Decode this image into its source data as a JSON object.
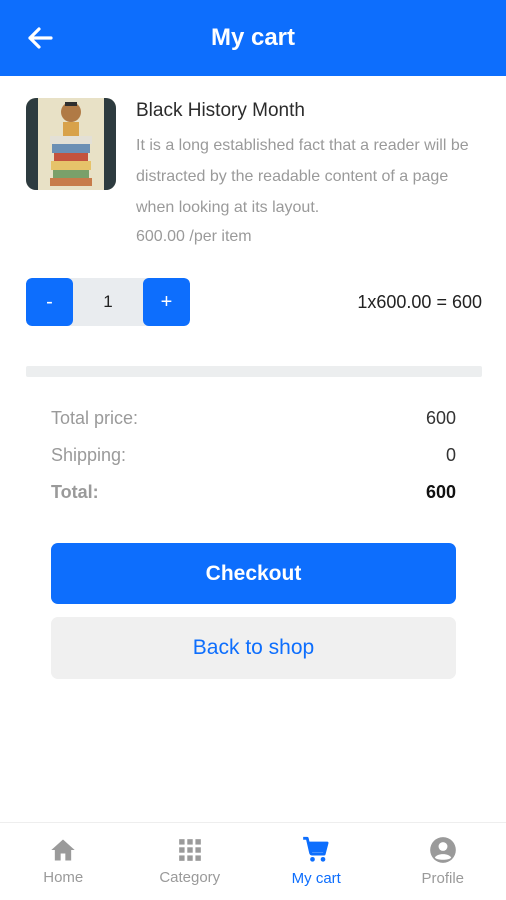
{
  "header": {
    "title": "My cart",
    "back_icon": "arrow-left-icon"
  },
  "product": {
    "name": "Black History Month",
    "description": "It is a long established fact that a reader will be distracted by the readable content of a page when looking at its layout.",
    "unit_price": "600.00 /per item"
  },
  "quantity": {
    "minus_label": "-",
    "value": "1",
    "plus_label": "+",
    "line_total": "1x600.00 = 600"
  },
  "summary": {
    "total_price_label": "Total price:",
    "total_price_value": "600",
    "shipping_label": "Shipping:",
    "shipping_value": "0",
    "total_label": "Total:",
    "total_value": "600"
  },
  "buttons": {
    "checkout": "Checkout",
    "back_to_shop": "Back to shop"
  },
  "nav": {
    "items": [
      {
        "label": "Home",
        "icon": "home-icon"
      },
      {
        "label": "Category",
        "icon": "grid-icon"
      },
      {
        "label": "My cart",
        "icon": "cart-icon",
        "active": true
      },
      {
        "label": "Profile",
        "icon": "account-circle-icon"
      }
    ]
  },
  "colors": {
    "primary": "#0d6efd",
    "muted": "#9a9a9a",
    "nav_inactive": "#9a9a9a"
  }
}
